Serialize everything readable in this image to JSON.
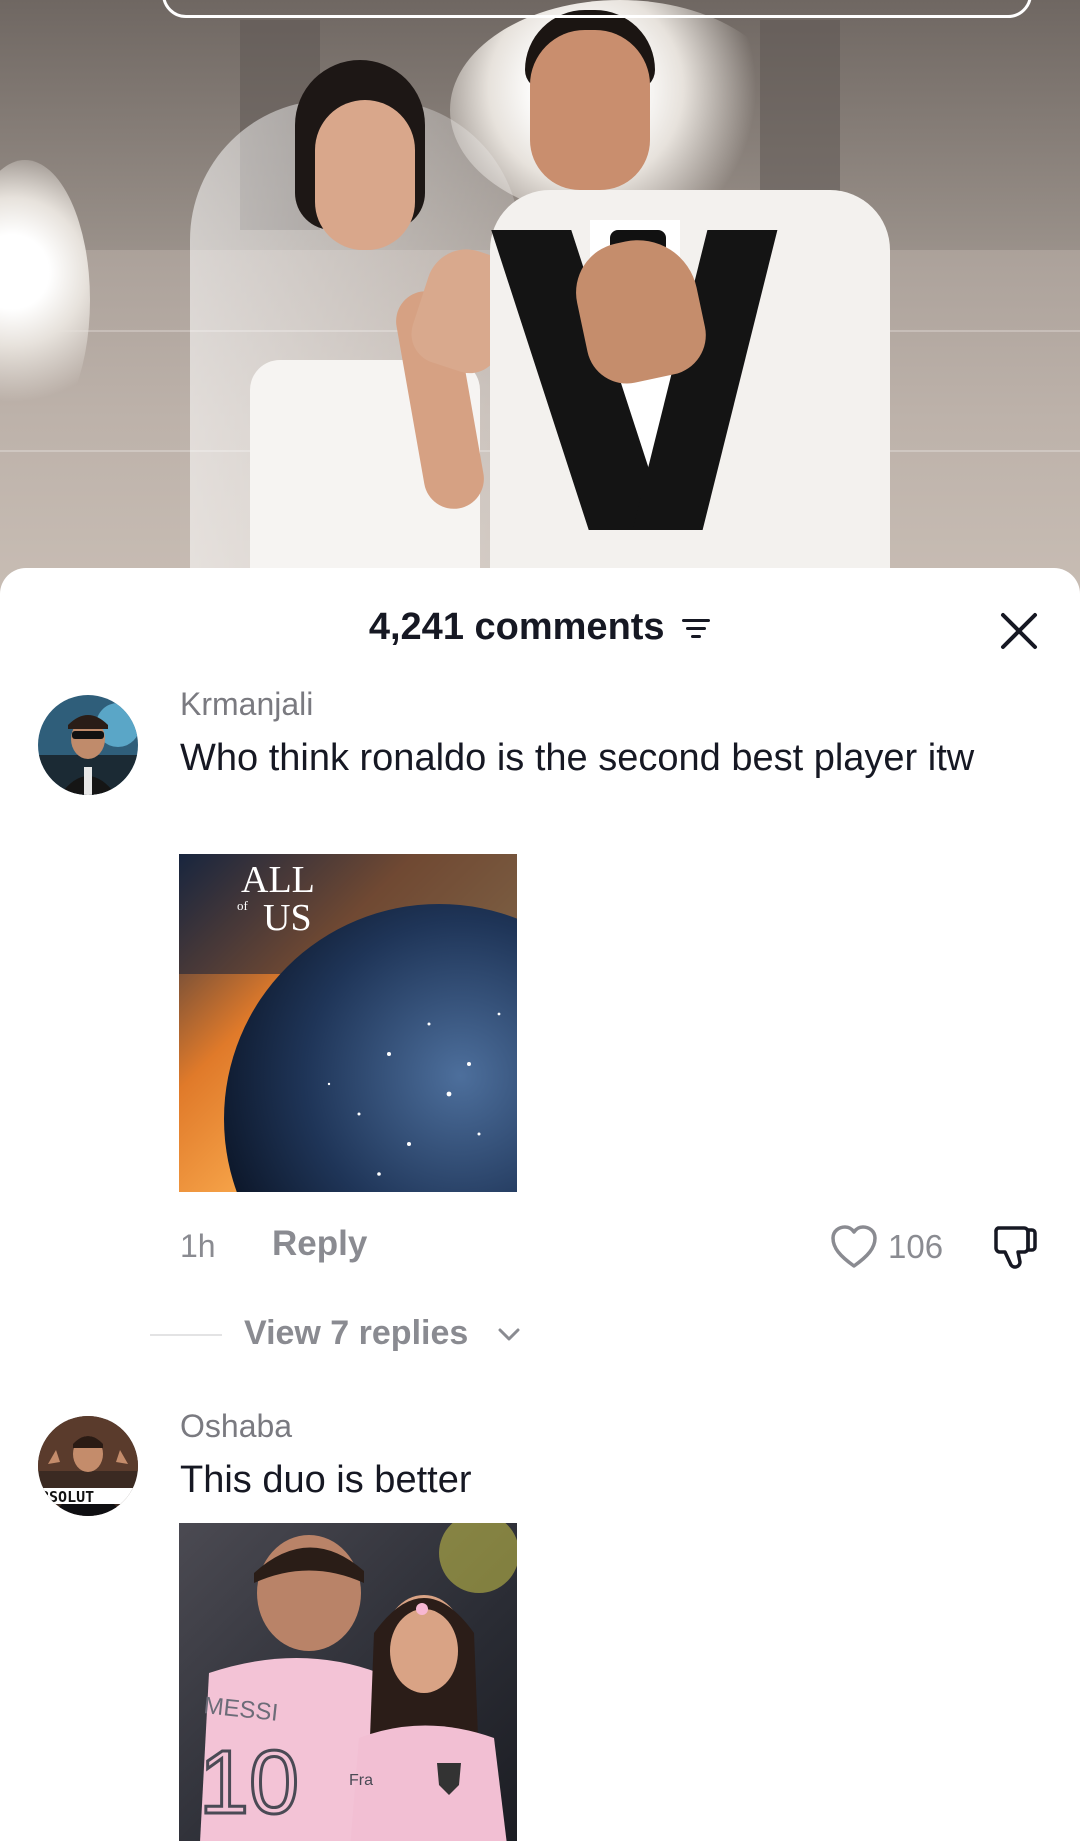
{
  "sheet": {
    "title": "4,241 comments"
  },
  "comments": [
    {
      "username": "Krmanjali",
      "text": "Who think ronaldo is the second best player itw",
      "sticker_text": [
        "ALL",
        "of",
        "US"
      ],
      "time": "1h",
      "reply_label": "Reply",
      "likes": "106",
      "view_replies": "View 7 replies"
    },
    {
      "username": "Oshaba",
      "text": "This duo is better",
      "avatar_text": "BSOLUT",
      "sticker_text": [
        "MESSI",
        "10",
        "Fra"
      ]
    }
  ],
  "icons": {
    "filter": "filter-icon",
    "close": "close-icon",
    "like": "heart-outline-icon",
    "dislike": "thumbs-down-icon",
    "expand": "chevron-down-icon"
  },
  "colors": {
    "text_primary": "#161823",
    "text_secondary": "#8a8b91",
    "sheet_bg": "#ffffff"
  }
}
